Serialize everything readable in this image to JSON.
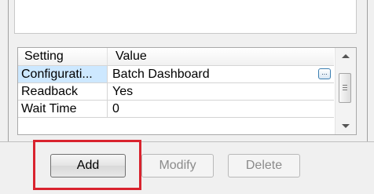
{
  "grid": {
    "headers": {
      "setting": "Setting",
      "value": "Value"
    },
    "rows": [
      {
        "setting": "Configurati...",
        "value": "Batch Dashboard",
        "selected": true
      },
      {
        "setting": "Readback",
        "value": "Yes"
      },
      {
        "setting": "Wait Time",
        "value": "0"
      }
    ],
    "ellipsis": "..."
  },
  "buttons": {
    "add": "Add",
    "modify": "Modify",
    "delete": "Delete"
  },
  "colors": {
    "highlight": "#d9232e",
    "selection": "#cde8ff"
  }
}
